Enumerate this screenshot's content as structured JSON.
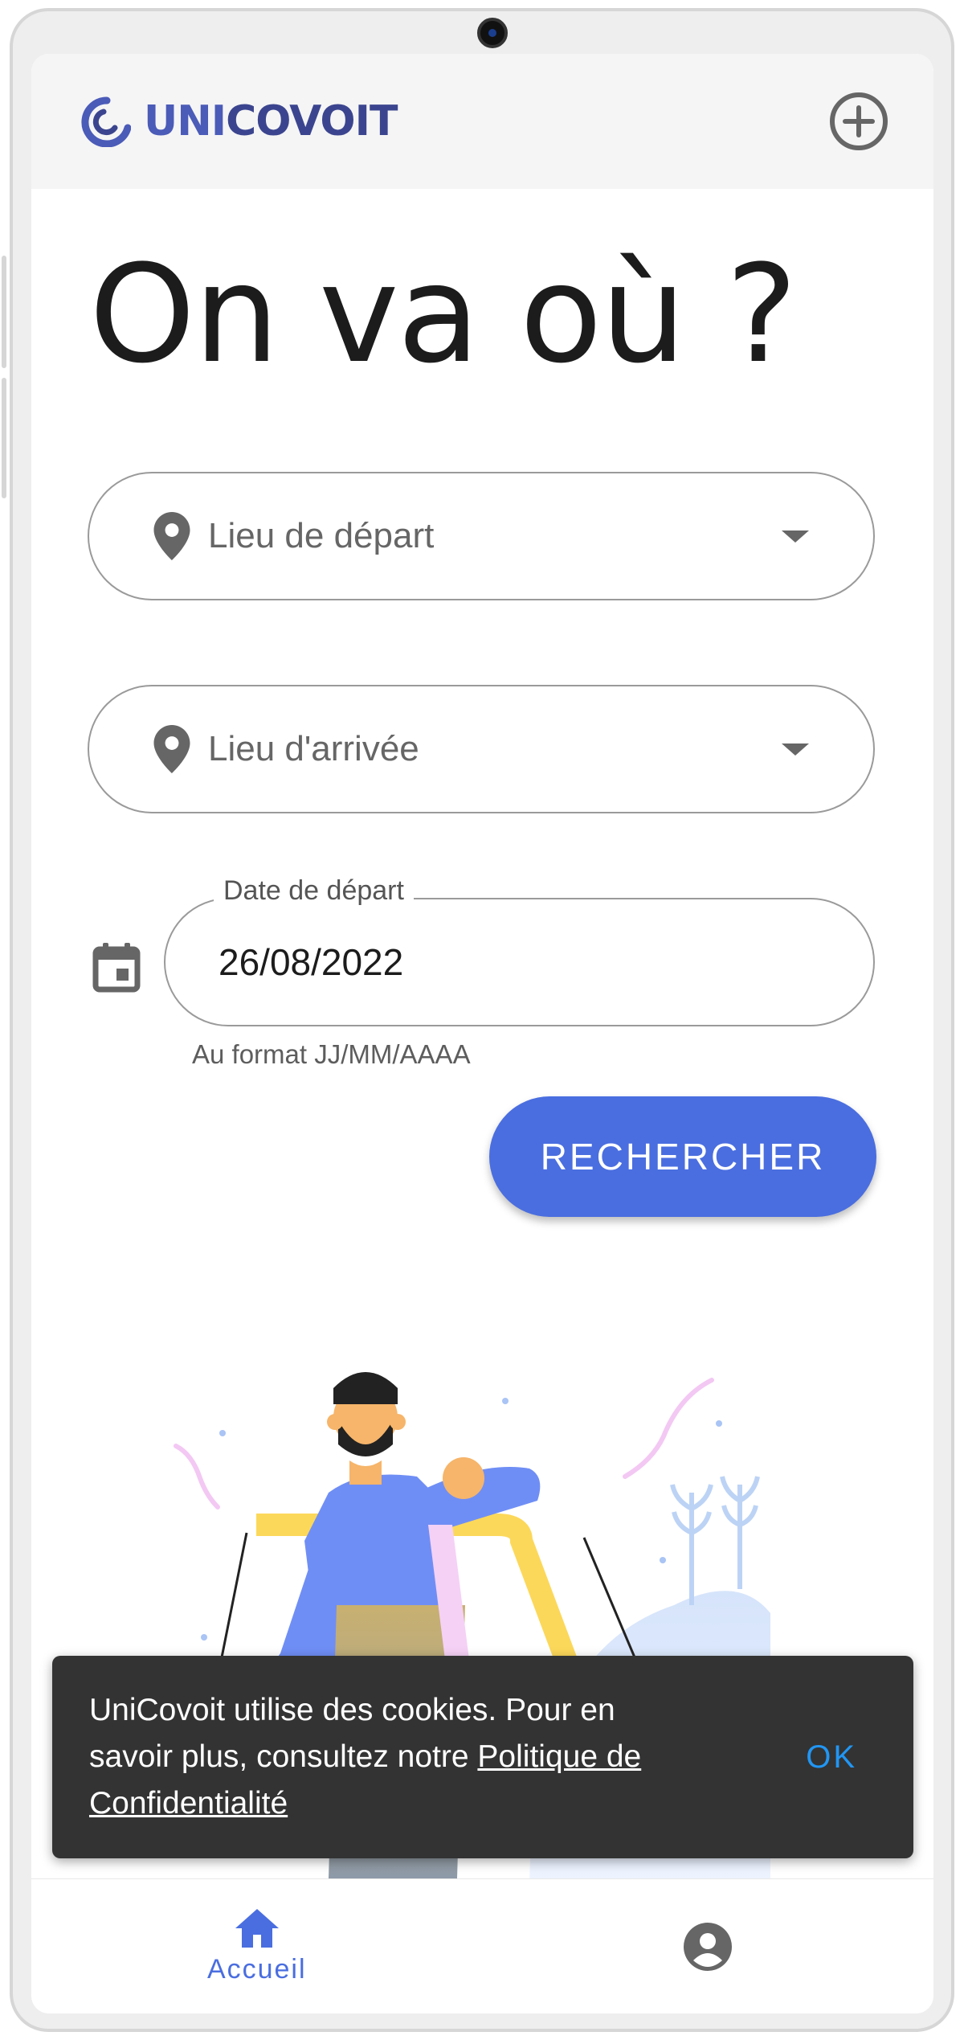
{
  "header": {
    "brand_part1": "UNI",
    "brand_part2": "COVOIT"
  },
  "search": {
    "title": "On va où ?",
    "departure_placeholder": "Lieu de départ",
    "arrival_placeholder": "Lieu d'arrivée",
    "date_label": "Date de départ",
    "date_value": "26/08/2022",
    "date_helper": "Au format JJ/MM/AAAA",
    "submit_label": "RECHERCHER"
  },
  "cookie": {
    "text_before": "UniCovoit utilise des cookies. Pour en savoir plus, consultez notre ",
    "link_text": "Politique de Confidentialité",
    "ok_label": "OK"
  },
  "nav": {
    "home_label": "Accueil"
  },
  "colors": {
    "primary": "#4a6ee0",
    "brand_dark": "#3b458f",
    "snackbar_bg": "#333333",
    "snackbar_action": "#2196f3"
  },
  "icons": {
    "add": "add-circle-icon",
    "location": "location-pin-icon",
    "calendar": "calendar-icon",
    "home": "home-icon",
    "account": "account-circle-icon"
  }
}
